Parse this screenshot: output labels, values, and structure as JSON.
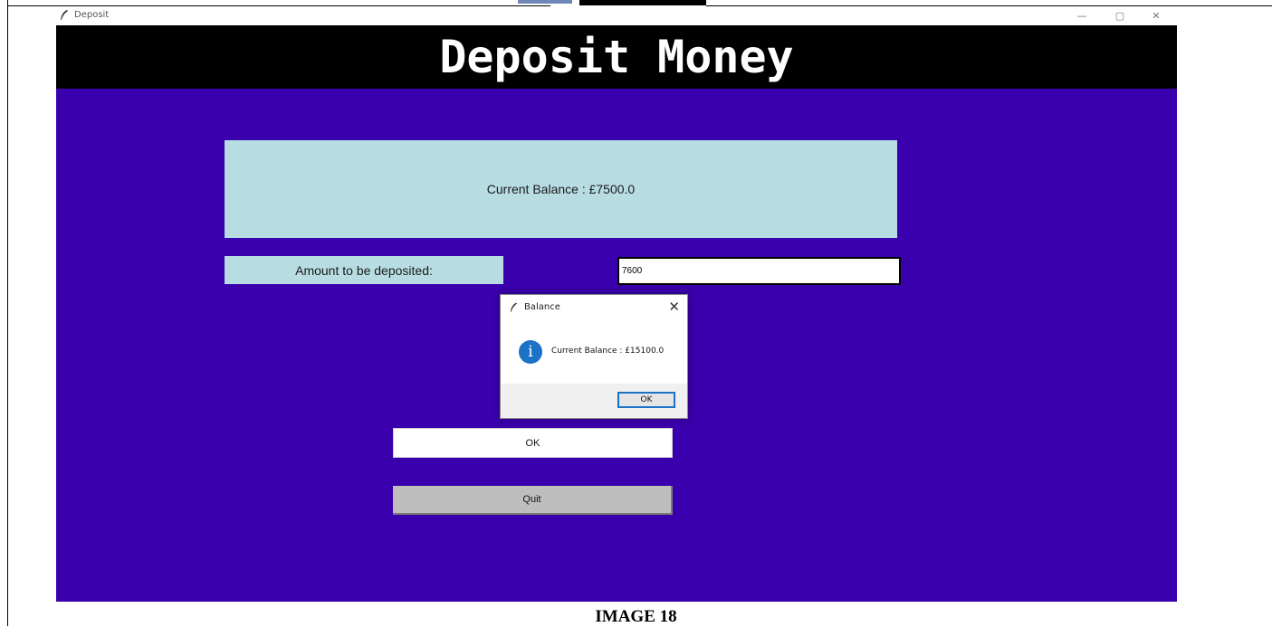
{
  "window": {
    "title": "Deposit",
    "controls": {
      "minimize": "—",
      "maximize": "▢",
      "close": "✕"
    }
  },
  "header": {
    "title": "Deposit Money"
  },
  "balance_panel": {
    "text": "Current Balance : £7500.0"
  },
  "amount": {
    "label": "Amount to be deposited:",
    "value": "7600"
  },
  "buttons": {
    "ok": "OK",
    "quit": "Quit"
  },
  "dialog": {
    "title": "Balance",
    "close": "✕",
    "message": "Current Balance : £15100.0",
    "ok": "OK",
    "icon_glyph": "i"
  },
  "caption": "IMAGE 18",
  "colors": {
    "client_bg": "#3a00ad",
    "panel_bg": "#b7dde3",
    "header_bg": "#000000",
    "info_blue": "#1a73c6"
  }
}
